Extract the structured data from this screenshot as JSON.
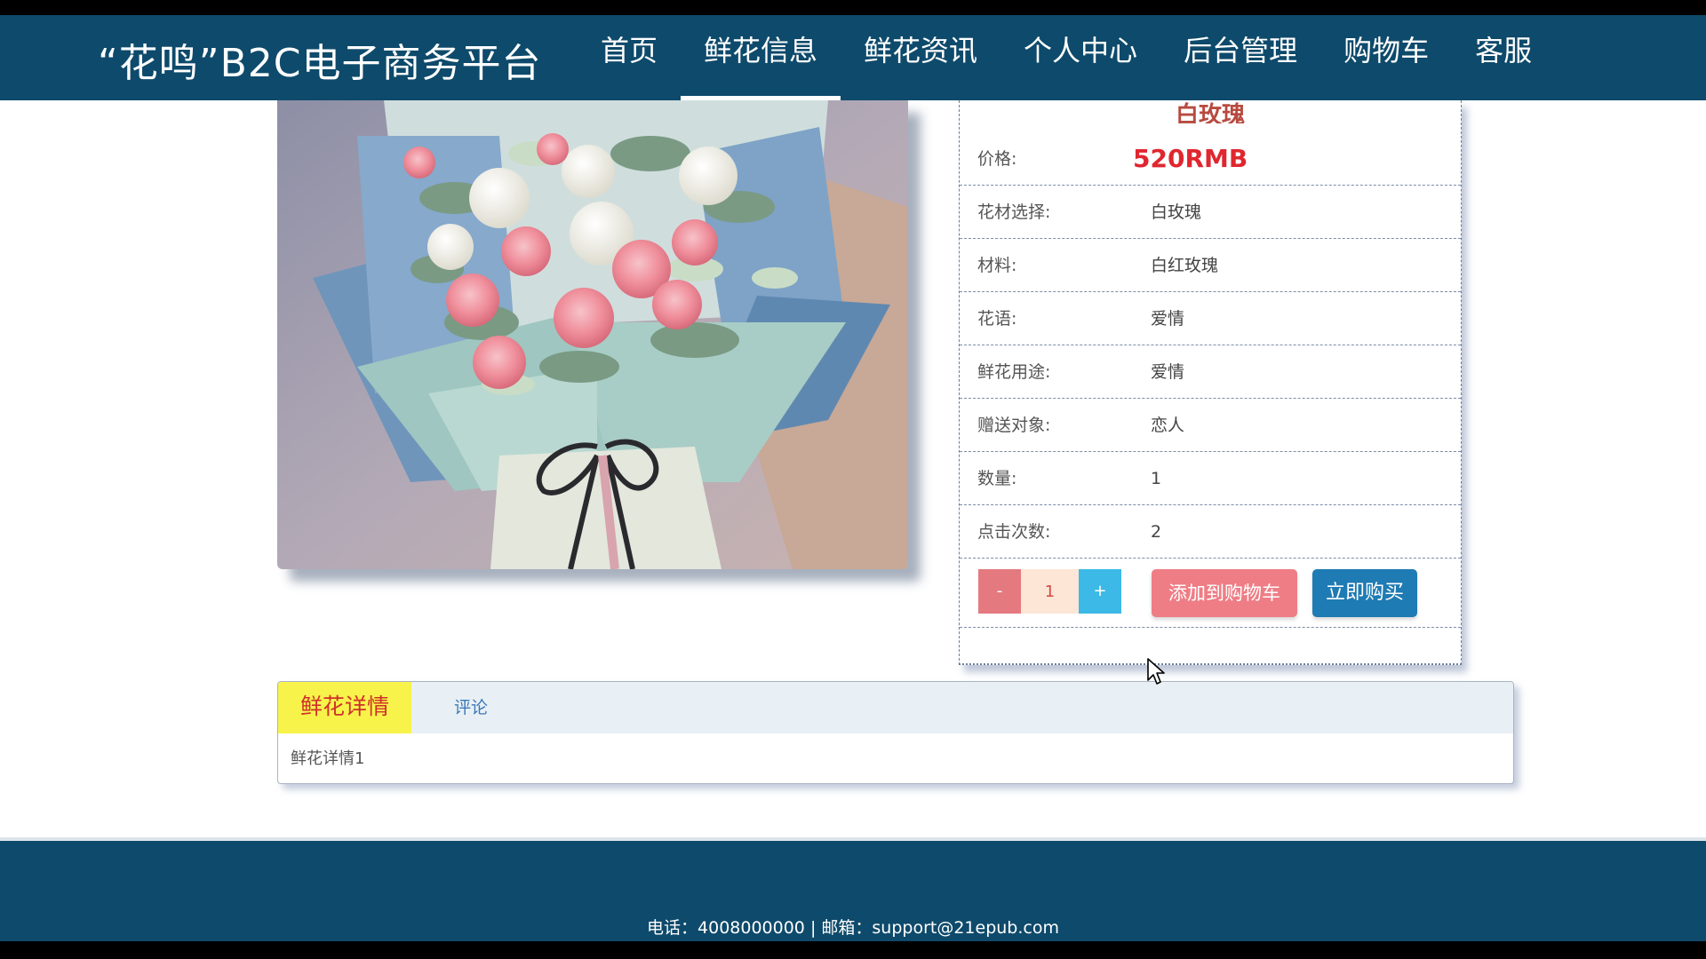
{
  "header": {
    "site_title": "“花鸣”B2C电子商务平台",
    "nav": [
      {
        "label": "首页",
        "active": false
      },
      {
        "label": "鲜花信息",
        "active": true
      },
      {
        "label": "鲜花资讯",
        "active": false
      },
      {
        "label": "个人中心",
        "active": false
      },
      {
        "label": "后台管理",
        "active": false
      },
      {
        "label": "购物车",
        "active": false
      },
      {
        "label": "客服",
        "active": false
      }
    ]
  },
  "product": {
    "name": "白玫瑰",
    "price_label": "价格:",
    "price_value": "520RMB",
    "attributes": [
      {
        "label": "花材选择:",
        "value": "白玫瑰"
      },
      {
        "label": "材料:",
        "value": "白红玫瑰"
      },
      {
        "label": "花语:",
        "value": "爱情"
      },
      {
        "label": "鲜花用途:",
        "value": "爱情"
      },
      {
        "label": "赠送对象:",
        "value": "恋人"
      },
      {
        "label": "数量:",
        "value": "1"
      },
      {
        "label": "点击次数:",
        "value": "2"
      }
    ]
  },
  "actions": {
    "minus_label": "-",
    "quantity": "1",
    "plus_label": "+",
    "add_to_cart": "添加到购物车",
    "buy_now": "立即购买"
  },
  "tabs": {
    "detail_label": "鲜花详情",
    "comment_label": "评论",
    "detail_content": "鲜花详情1"
  },
  "footer": {
    "contact": "电话：4008000000 | 邮箱：support@21epub.com"
  },
  "colors": {
    "header_bg": "#0e4a6b",
    "price": "#e0262f",
    "cart_button": "#ef7d85",
    "buy_button": "#1e7bb3",
    "active_tab": "#f7f34a"
  }
}
